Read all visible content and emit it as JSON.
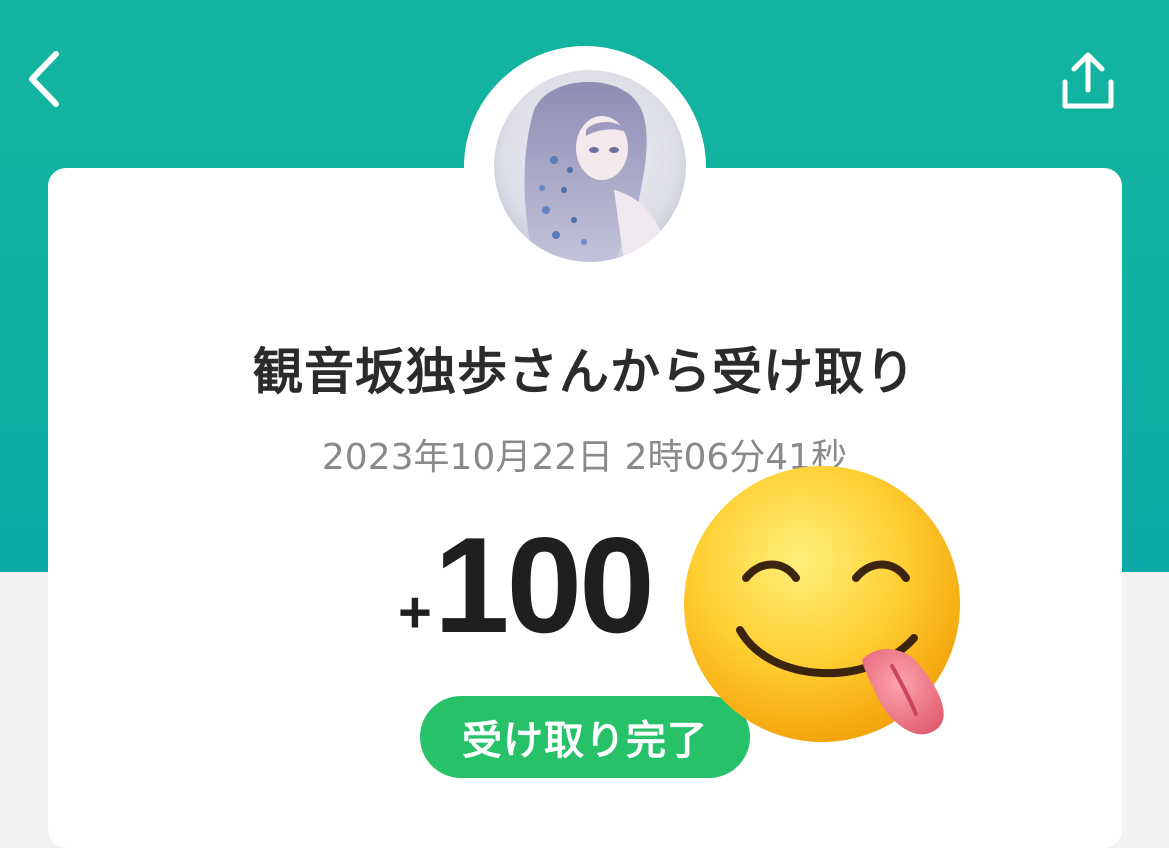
{
  "header": {
    "back_icon": "chevron-left-icon",
    "share_icon": "share-upload-icon",
    "accent_color": "#13b59f"
  },
  "transaction": {
    "title": "観音坂独歩さんから受け取り",
    "timestamp": "2023年10月22日 2時06分41秒",
    "amount_sign": "+",
    "amount_value": "100",
    "status": "受け取り完了",
    "status_color": "#27c16a"
  },
  "overlay": {
    "emoji": "face-savoring-food-emoji"
  }
}
